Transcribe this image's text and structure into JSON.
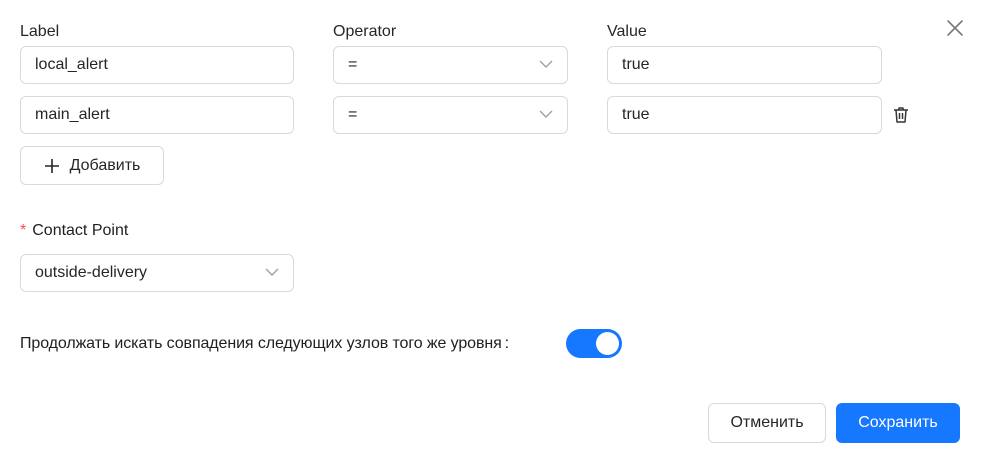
{
  "headers": {
    "label": "Label",
    "operator": "Operator",
    "value": "Value"
  },
  "matchers": [
    {
      "label": "local_alert",
      "operator": "=",
      "value": "true"
    },
    {
      "label": "main_alert",
      "operator": "=",
      "value": "true"
    }
  ],
  "add_button": {
    "label": "Добавить",
    "icon": "plus-icon"
  },
  "contact_point": {
    "required_mark": "*",
    "label": "Contact Point",
    "value": "outside-delivery"
  },
  "continue_matching": {
    "label": "Продолжать искать совпадения следующих узлов того же уровня",
    "enabled": true
  },
  "footer": {
    "cancel_label": "Отменить",
    "save_label": "Сохранить"
  },
  "colors": {
    "primary": "#1677ff",
    "required": "#ff4d4f",
    "border": "#d9d9d9"
  },
  "icons": {
    "close": "close-icon",
    "delete": "trash-icon",
    "dropdown": "chevron-down-icon"
  }
}
